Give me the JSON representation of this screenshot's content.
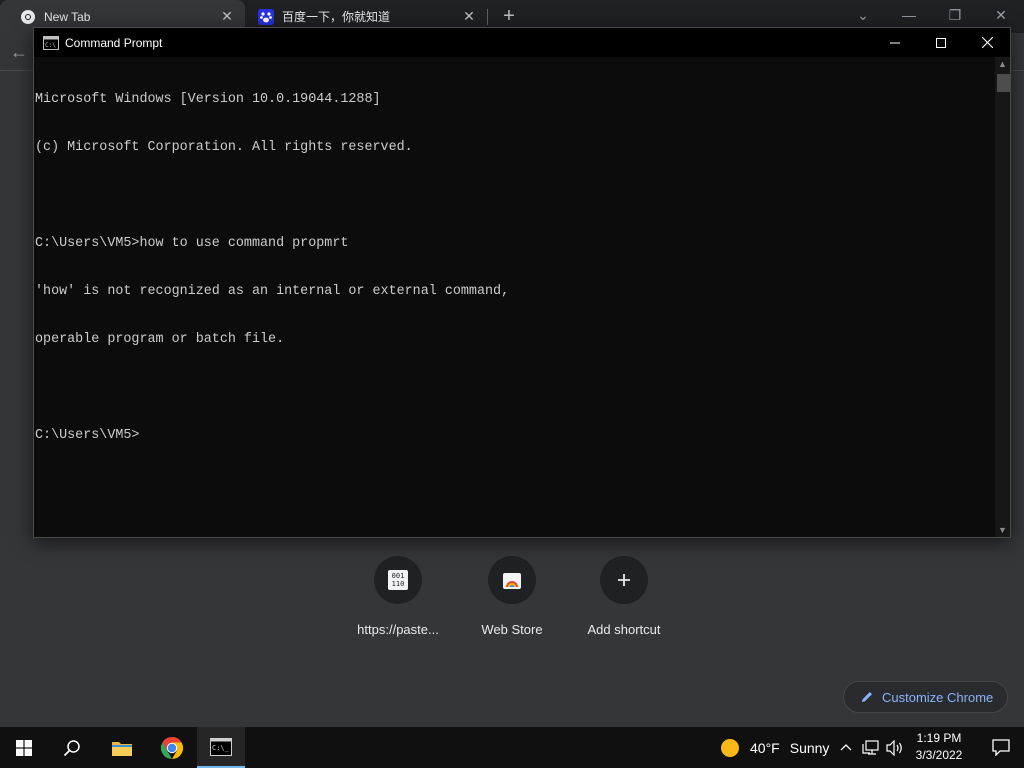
{
  "browser": {
    "tabs": [
      {
        "title": "New Tab",
        "active": true,
        "close": "✕"
      },
      {
        "title": "百度一下，你就知道",
        "active": false,
        "close": "✕"
      }
    ],
    "new_tab": "+",
    "window_controls": {
      "tab_search": "⌄",
      "minimize": "—",
      "restore": "❐",
      "close": "✕"
    },
    "back": "←",
    "shortcuts": [
      {
        "label": "https://paste...",
        "icon": "pastebin-icon"
      },
      {
        "label": "Web Store",
        "icon": "web-store-icon"
      },
      {
        "label": "Add shortcut",
        "icon": "plus-icon"
      }
    ],
    "customize_label": "Customize Chrome",
    "accent_color": "#8ab4f8"
  },
  "cmd": {
    "title": "Command Prompt",
    "lines": [
      "Microsoft Windows [Version 10.0.19044.1288]",
      "(c) Microsoft Corporation. All rights reserved.",
      "",
      "C:\\Users\\VM5>how to use command propmrt",
      "'how' is not recognized as an internal or external command,",
      "operable program or batch file.",
      "",
      "C:\\Users\\VM5>"
    ]
  },
  "taskbar": {
    "weather_temp": "40°F",
    "weather_desc": "Sunny",
    "time": "1:19 PM",
    "date": "3/3/2022"
  }
}
